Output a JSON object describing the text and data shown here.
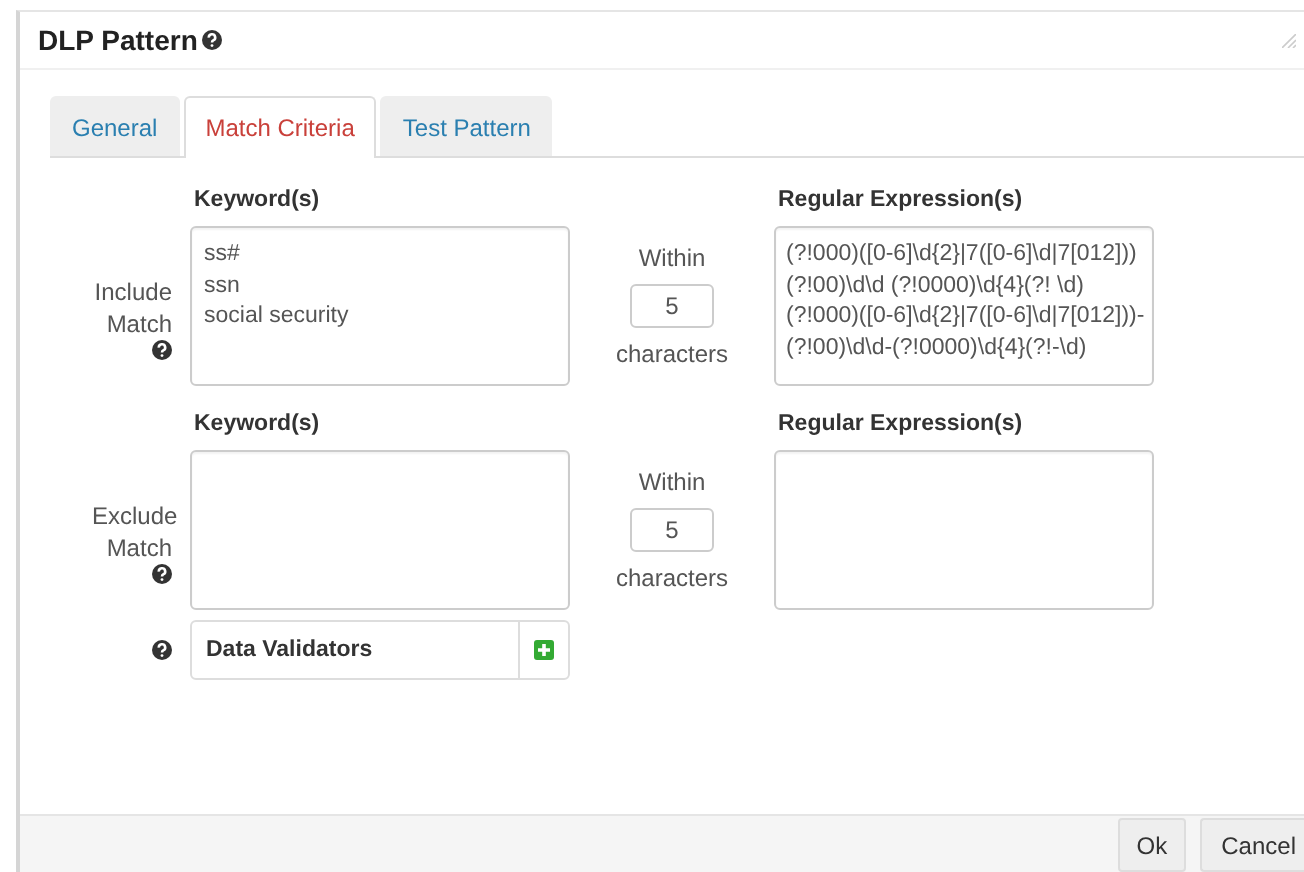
{
  "dialog": {
    "title": "DLP Pattern"
  },
  "tabs": [
    {
      "label": "General",
      "selected": false
    },
    {
      "label": "Match Criteria",
      "selected": true
    },
    {
      "label": "Test Pattern",
      "selected": false
    }
  ],
  "sections": [
    {
      "label": "Include Match",
      "keywords_label": "Keyword(s)",
      "keywords": "ss#\nssn\nsocial security",
      "within_label": "Within",
      "within": "5",
      "unit": "characters",
      "regex_label": "Regular Expression(s)",
      "regex": "(?!000)([0-6]\\d{2}|7([0-6]\\d|7[012]))\n(?!00)\\d\\d (?!0000)\\d{4}(?! \\d)\n(?!000)([0-6]\\d{2}|7([0-6]\\d|7[012]))-\n(?!00)\\d\\d-(?!0000)\\d{4}(?!-\\d)"
    },
    {
      "label": "Exclude Match",
      "keywords_label": "Keyword(s)",
      "within_label": "Within",
      "within": "5",
      "unit": "characters",
      "regex_label": "Regular Expression(s)"
    }
  ],
  "validators": {
    "label": "Data Validators"
  },
  "buttons": [
    "Ok",
    "Cancel"
  ]
}
